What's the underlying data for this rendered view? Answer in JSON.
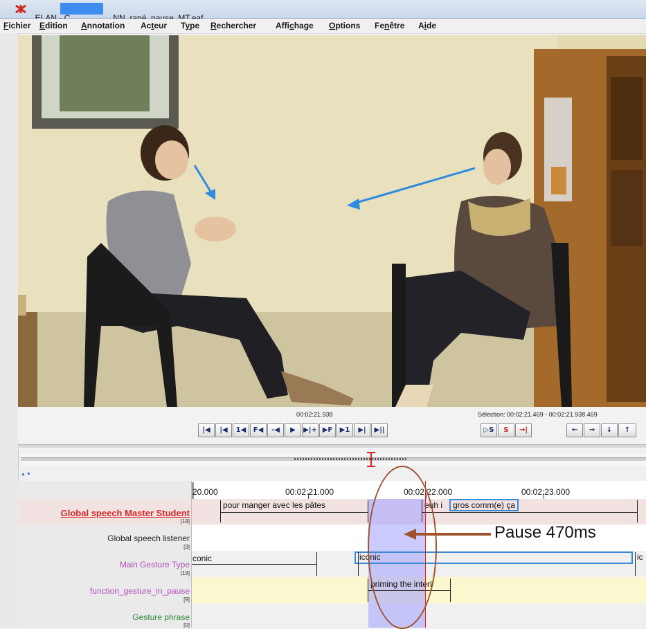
{
  "window": {
    "title_left": "ELAN - C",
    "title_right": "NN_rapé_pause_MT.eaf"
  },
  "menu": [
    {
      "label": "Fichier",
      "u": "F",
      "rest": "ichier"
    },
    {
      "label": "Edition",
      "u": "E",
      "rest": "dition"
    },
    {
      "label": "Annotation",
      "u": "A",
      "rest": "nnotation"
    },
    {
      "label": "Acteur",
      "pre": "Ac",
      "u": "t",
      "rest": "eur"
    },
    {
      "label": "Type",
      "pre": "T",
      "u": "y",
      "rest": "pe"
    },
    {
      "label": "Rechercher",
      "u": "R",
      "rest": "echercher"
    },
    {
      "label": "Affichage",
      "pre": "Affi",
      "u": "c",
      "rest": "hage"
    },
    {
      "label": "Options",
      "u": "O",
      "rest": "ptions"
    },
    {
      "label": "Fenêtre",
      "pre": "Fe",
      "u": "n",
      "rest": "être"
    },
    {
      "label": "Aide",
      "pre": "A",
      "u": "i",
      "rest": "de"
    }
  ],
  "player": {
    "timecode": "00:02:21.938",
    "selection": "Sélection: 00:02:21.469 - 00:02:21.938  469",
    "buttons_left": [
      "|◀",
      "|◀",
      "1◀",
      "F◀",
      "-◀",
      "▶",
      "▶|+",
      "▶F",
      "▶1",
      "▶|",
      "▶||"
    ],
    "buttons_right": [
      "▷S",
      "S",
      "→|"
    ],
    "buttons_nav": [
      "←",
      "→",
      "↓",
      "↑"
    ]
  },
  "ruler": {
    "labels": [
      "20.000",
      "00:02:21.000",
      "00:02:22.000",
      "00:02:23.000"
    ]
  },
  "tiers": [
    {
      "name": "Global speech Master Student",
      "count": "[19]",
      "color": "#d12a2a",
      "bg": "#f2e2e2",
      "underline": true
    },
    {
      "name": "Global speech listener",
      "count": "[3]",
      "color": "#222222",
      "bg": "#ffffff"
    },
    {
      "name": "Main Gesture Type",
      "count": "[19]",
      "color": "#b04cbb",
      "bg": "#f0f0f0"
    },
    {
      "name": "function_gesture_in_pause",
      "count": "[9]",
      "color": "#b04cbb",
      "bg": "#fbf7cf"
    },
    {
      "name": "Gesture phrase",
      "count": "[0]",
      "color": "#2f8a3a",
      "bg": "#f0f0f0"
    }
  ],
  "annotations": {
    "speech1": "pour manger avec les pâtes",
    "speech2": "euh i",
    "speech3": "gros comm(e) ça",
    "gesture1": "conic",
    "gesture2": "iconic",
    "gesture3": "ic",
    "function1": "priming the interl"
  },
  "overlay": {
    "pause_label": "Pause 470ms"
  },
  "colors": {
    "accent_red": "#e0201a",
    "selection_blue": "#a0a0ff",
    "annotation_arrow": "#a0522d",
    "video_arrow": "#2f8be0"
  }
}
